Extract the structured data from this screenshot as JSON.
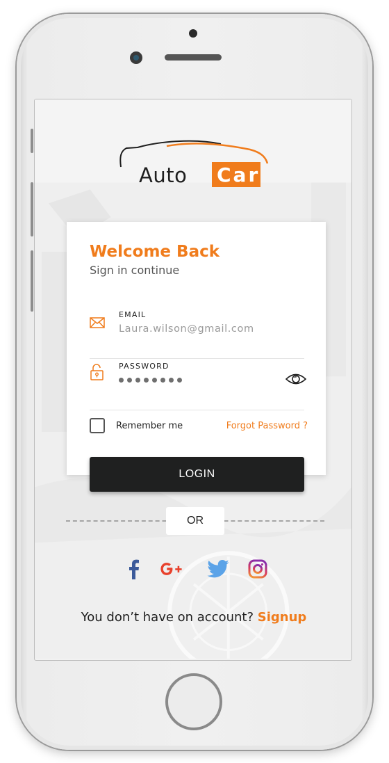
{
  "brand": {
    "logo_part1": "Auto",
    "logo_part2": "Car",
    "accent_color": "#f07c1c"
  },
  "login_card": {
    "title": "Welcome Back",
    "subtitle": "Sign in continue",
    "email": {
      "label": "EMAIL",
      "value": "Laura.wilson@gmail.com",
      "icon": "envelope-icon"
    },
    "password": {
      "label": "PASSWORD",
      "masked_length": 8,
      "icon": "unlock-icon",
      "toggle_icon": "eye-icon"
    },
    "remember_label": "Remember me",
    "remember_checked": false,
    "forgot_label": "Forgot Password ?"
  },
  "login_button_label": "LOGIN",
  "divider_label": "OR",
  "social": [
    {
      "name": "facebook",
      "icon": "facebook-icon"
    },
    {
      "name": "google-plus",
      "icon": "google-plus-icon"
    },
    {
      "name": "twitter",
      "icon": "twitter-icon"
    },
    {
      "name": "instagram",
      "icon": "instagram-icon"
    }
  ],
  "signup": {
    "prompt": "You don’t have on account?",
    "link": "Signup"
  }
}
